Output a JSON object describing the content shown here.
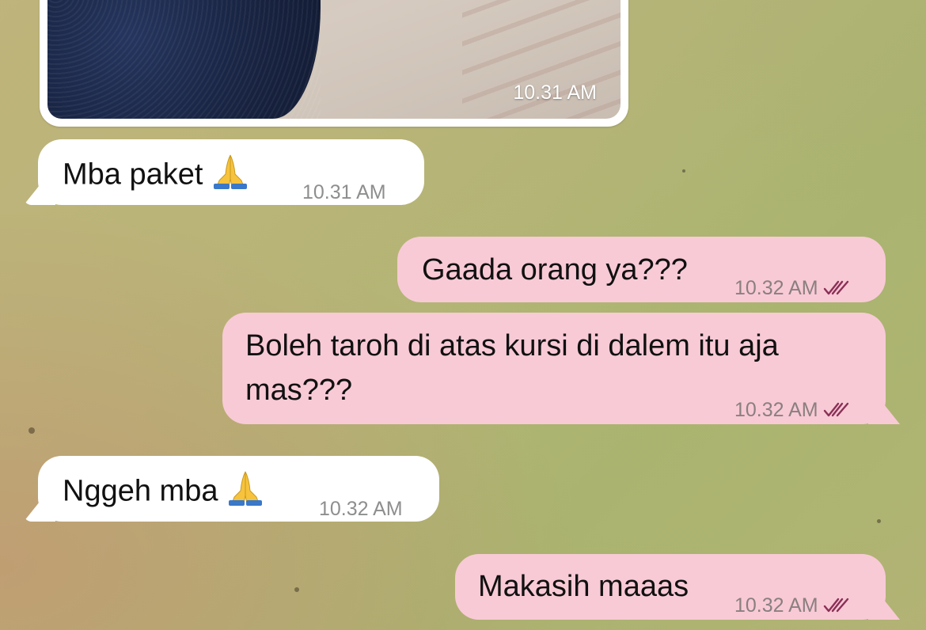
{
  "colors": {
    "outgoing_bubble": "#f8cad6",
    "incoming_bubble": "#ffffff",
    "read_checks": "#8b2f56"
  },
  "photo_message": {
    "time": "10.31 AM"
  },
  "messages": [
    {
      "direction": "incoming",
      "text": "Mba paket",
      "emoji": "folded-hands-icon",
      "time": "10.31 AM"
    },
    {
      "direction": "outgoing",
      "text": "Gaada orang ya???",
      "time": "10.32 AM",
      "status": "read-double-check"
    },
    {
      "direction": "outgoing",
      "text_line1": "Boleh taroh di atas kursi di dalem itu aja",
      "text_line2": "mas???",
      "time": "10.32 AM",
      "status": "read-double-check"
    },
    {
      "direction": "incoming",
      "text": "Nggeh mba",
      "emoji": "folded-hands-icon",
      "time": "10.32 AM"
    },
    {
      "direction": "outgoing",
      "text": "Makasih maaas",
      "time": "10.32 AM",
      "status": "read-double-check"
    }
  ]
}
